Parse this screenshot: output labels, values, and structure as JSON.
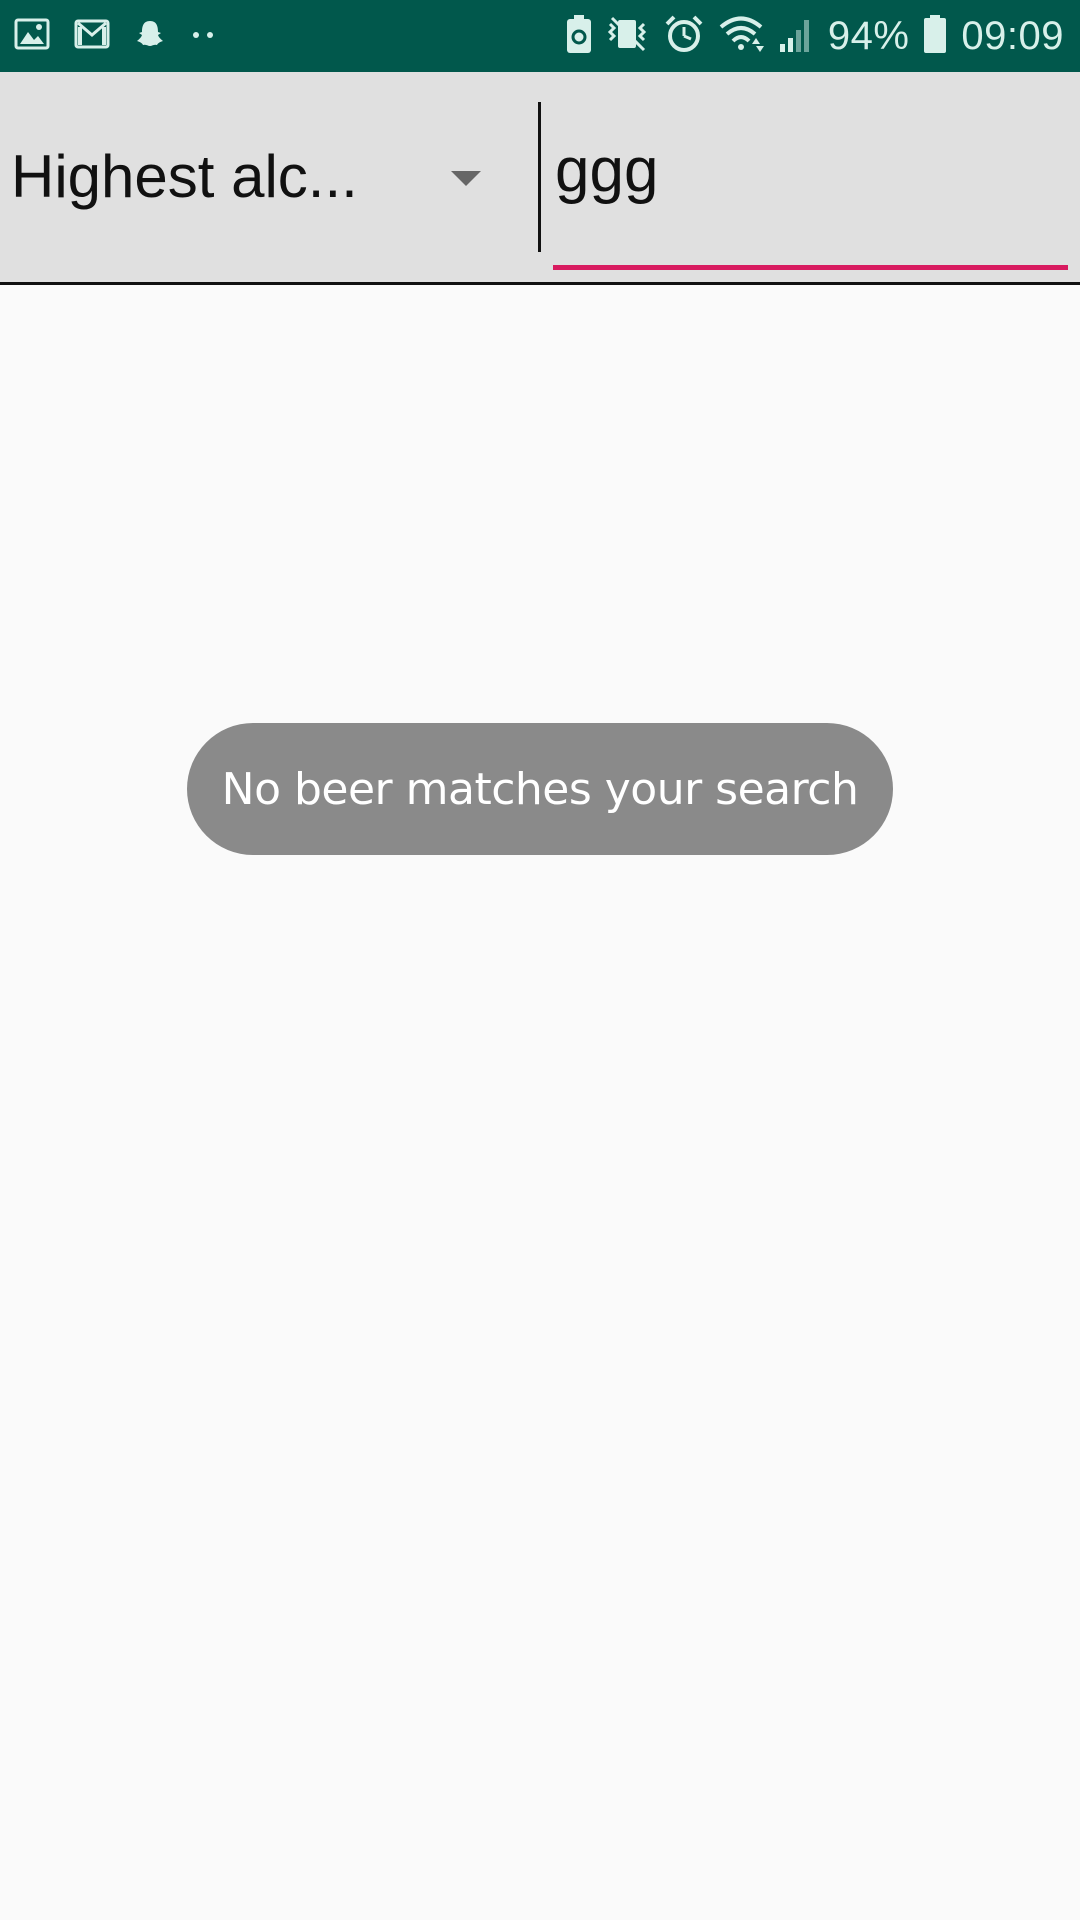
{
  "status_bar": {
    "notifications": [
      "gallery-icon",
      "gmail-icon",
      "snapchat-icon",
      "more-dots-icon"
    ],
    "system_icons": [
      "battery-saver-icon",
      "vibrate-icon",
      "alarm-icon",
      "wifi-icon",
      "signal-icon",
      "battery-icon"
    ],
    "battery_percent": "94%",
    "time": "09:09",
    "background_color": "#01584c"
  },
  "toolbar": {
    "sort_selected": "Highest alc...",
    "search_value": "ggg",
    "accent_color": "#d81b60"
  },
  "toast": {
    "message": "No beer matches your search"
  }
}
